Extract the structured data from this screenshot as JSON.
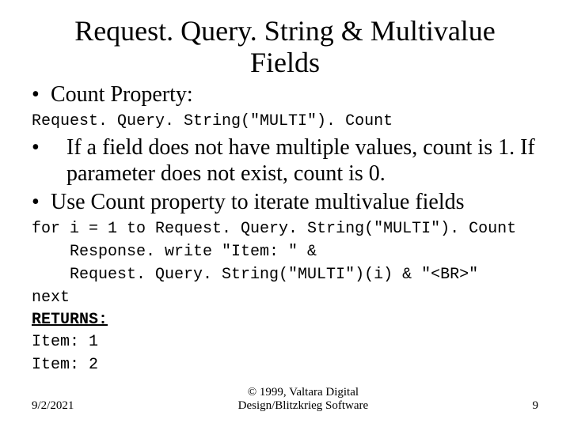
{
  "title_line1": "Request. Query. String & Multivalue",
  "title_line2": "Fields",
  "bullets": [
    "Count Property:",
    "If a field does not have multiple values, count is 1. If parameter does not exist, count is 0.",
    "Use Count property to iterate multivalue fields"
  ],
  "code1": "Request. Query. String(\"MULTI\"). Count",
  "code2_line1": "for i = 1 to Request. Query. String(\"MULTI\"). Count",
  "code2_line2": "    Response. write \"Item: \" &",
  "code2_line3": "    Request. Query. String(\"MULTI\")(i) & \"<BR>\"",
  "code2_line4": "next",
  "returns_label": "RETURNS:",
  "returns_line1": "Item: 1",
  "returns_line2": "Item: 2",
  "footer": {
    "date": "9/2/2021",
    "copyright_line1": "© 1999, Valtara Digital",
    "copyright_line2": "Design/Blitzkrieg Software",
    "page": "9"
  }
}
